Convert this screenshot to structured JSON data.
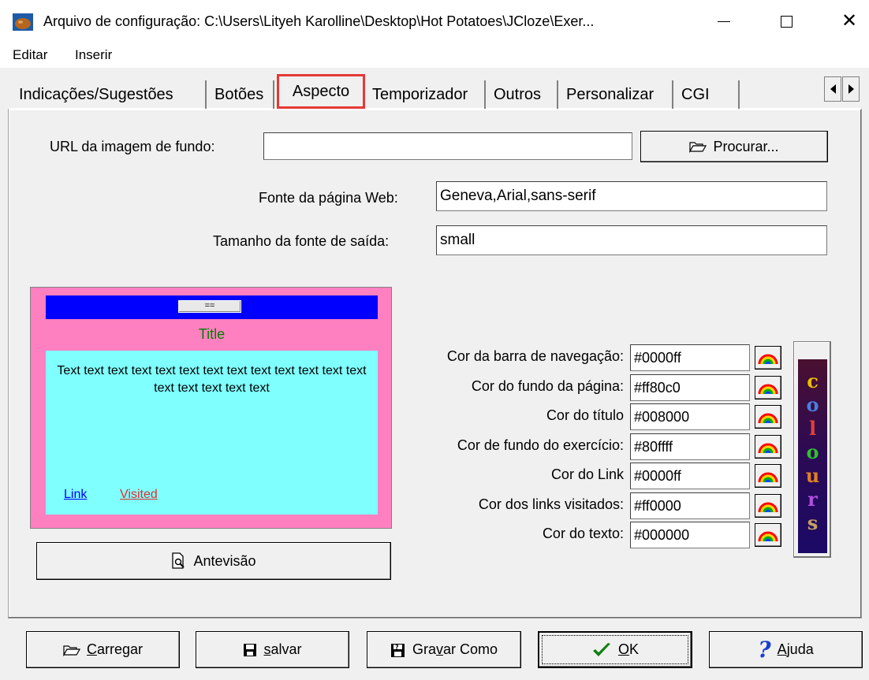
{
  "window": {
    "title": "Arquivo de configuração: C:\\Users\\Lityeh Karolline\\Desktop\\Hot Potatoes\\JCloze\\Exer...",
    "minimize": "—",
    "maximize": "☐",
    "close": "✕"
  },
  "menu": {
    "items": [
      "Editar",
      "Inserir"
    ]
  },
  "tabs": [
    {
      "label": "Indicações/Sugestões"
    },
    {
      "label": "Botões"
    },
    {
      "label": "Aspecto",
      "active": true
    },
    {
      "label": "Temporizador"
    },
    {
      "label": "Outros"
    },
    {
      "label": "Personalizar"
    },
    {
      "label": "CGI"
    }
  ],
  "form": {
    "bg_image_label": "URL da imagem de fundo:",
    "bg_image_value": "",
    "browse_label": "Procurar...",
    "font_label": "Fonte da página Web:",
    "font_value": "Geneva,Arial,sans-serif",
    "font_size_label": "Tamanho da fonte de saída:",
    "font_size_value": "small"
  },
  "preview": {
    "nav_button": "==",
    "title": "Title",
    "body_text": "Text text text text text text text text text text text text text text text text text text",
    "link": "Link",
    "visited": "Visited",
    "button_label": "Antevisão",
    "colors": {
      "nav": "#0000ff",
      "page": "#ff80c0",
      "title": "#008000",
      "exercise_bg": "#80ffff",
      "link": "#0000ff",
      "visited": "#ff0000",
      "text": "#000000"
    }
  },
  "colors": [
    {
      "label": "Cor da barra de navegação:",
      "value": "#0000ff"
    },
    {
      "label": "Cor do fundo da página:",
      "value": "#ff80c0"
    },
    {
      "label": "Cor do título",
      "value": "#008000"
    },
    {
      "label": "Cor de fundo do exercício:",
      "value": "#80ffff"
    },
    {
      "label": "Cor do Link",
      "value": "#0000ff"
    },
    {
      "label": "Cor dos links visitados:",
      "value": "#ff0000"
    },
    {
      "label": "Cor do texto:",
      "value": "#000000"
    }
  ],
  "colours_logo": [
    "c",
    "o",
    "l",
    "o",
    "u",
    "r",
    "s"
  ],
  "buttons": {
    "load": {
      "accel": "C",
      "rest": "arregar"
    },
    "save": {
      "accel": "s",
      "rest": "alvar"
    },
    "save_as": {
      "pre": "Gra",
      "accel": "v",
      "rest": "ar Como"
    },
    "ok": {
      "accel": "O",
      "rest": "K"
    },
    "help": {
      "accel": "A",
      "rest": "juda"
    }
  }
}
